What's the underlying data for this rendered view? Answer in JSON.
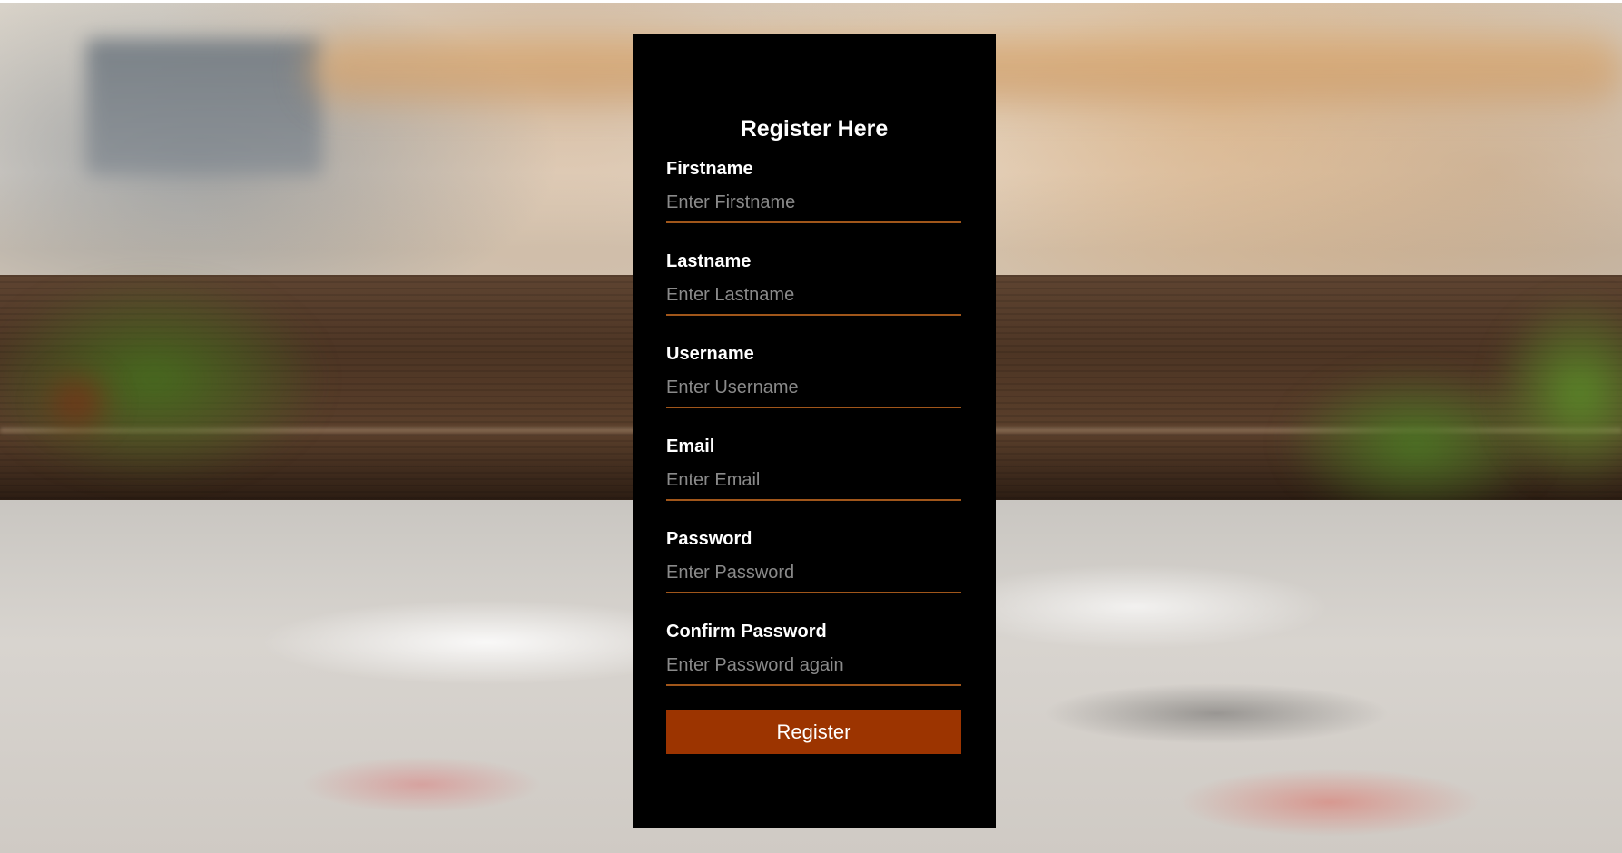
{
  "form": {
    "title": "Register Here",
    "fields": [
      {
        "label": "Firstname",
        "placeholder": "Enter Firstname",
        "value": ""
      },
      {
        "label": "Lastname",
        "placeholder": "Enter Lastname",
        "value": ""
      },
      {
        "label": "Username",
        "placeholder": "Enter Username",
        "value": ""
      },
      {
        "label": "Email",
        "placeholder": "Enter Email",
        "value": ""
      },
      {
        "label": "Password",
        "placeholder": "Enter Password",
        "value": ""
      },
      {
        "label": "Confirm Password",
        "placeholder": "Enter Password again",
        "value": ""
      }
    ],
    "submit_label": "Register"
  },
  "colors": {
    "card_background": "#000000",
    "accent_underline": "#a0561a",
    "button_background": "#9c3400",
    "text": "#ffffff",
    "placeholder": "#8a8a8a"
  }
}
